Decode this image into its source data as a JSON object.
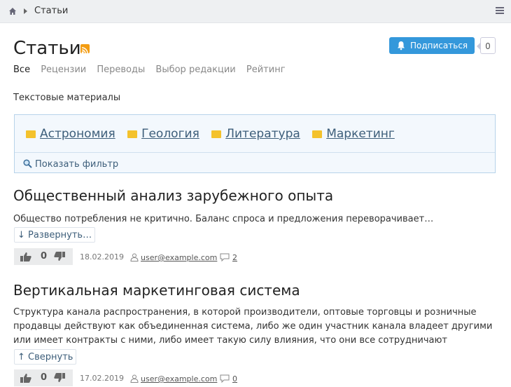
{
  "breadcrumb": {
    "current": "Статьи"
  },
  "header": {
    "title": "Статьи",
    "subscribe_label": "Подписаться",
    "subscribers_count": "0"
  },
  "tabs": [
    "Все",
    "Рецензии",
    "Переводы",
    "Выбор редакции",
    "Рейтинг"
  ],
  "section_subtitle": "Текстовые материалы",
  "categories": [
    "Астрономия",
    "Геология",
    "Литература",
    "Маркетинг"
  ],
  "filter_label": "Показать фильтр",
  "posts": [
    {
      "title": "Общественный анализ зарубежного опыта",
      "body": "Общество потребления не критично. Баланс спроса и предложения переворачивает…",
      "toggle": "↓ Развернуть…",
      "votes": "0",
      "date": "18.02.2019",
      "user": "user@example.com",
      "comments": "2"
    },
    {
      "title": "Вертикальная маркетинговая система",
      "body": "Структура канала распространения, в которой производители, оптовые торговцы и розничные продавцы действуют как объединенная система, либо же один участник канала владеет другими или имеет контракты с ними, либо имеет такую силу влияния, что они все сотрудничают",
      "toggle": "↑ Свернуть",
      "votes": "0",
      "date": "17.02.2019",
      "user": "user@example.com",
      "comments": "0"
    }
  ],
  "colors": {
    "accent": "#3498db",
    "link": "#3d5e7a",
    "folder": "#f4c22c",
    "rss": "#f39c12"
  }
}
